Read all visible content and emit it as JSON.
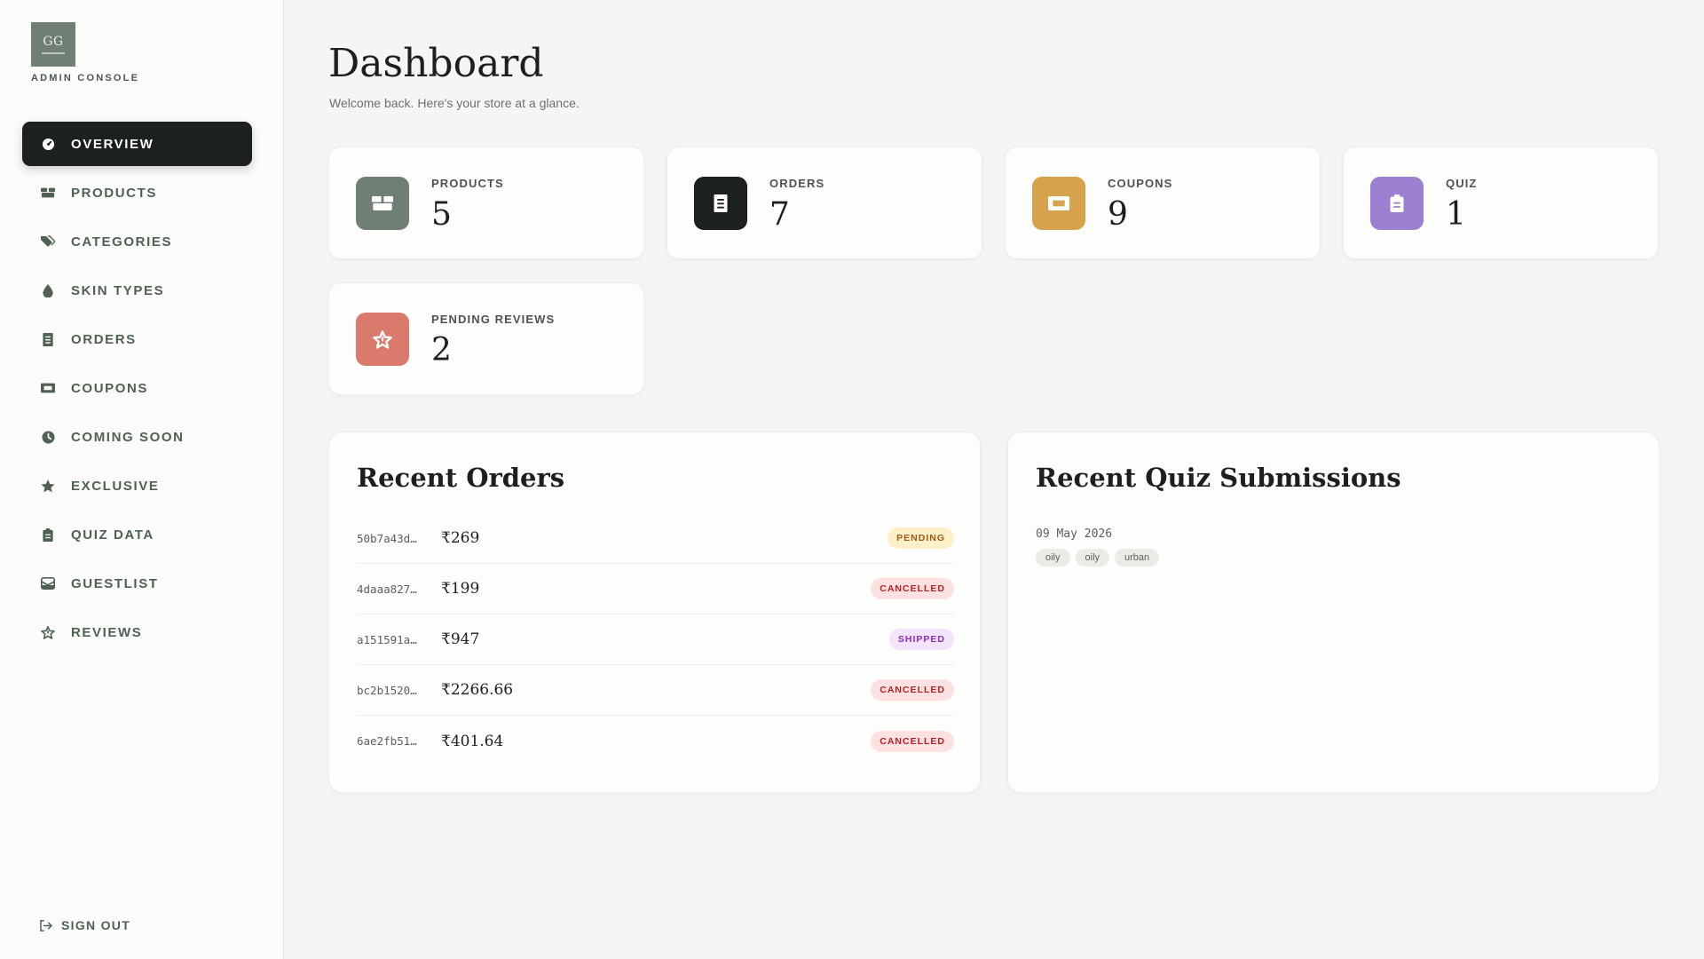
{
  "sidebar": {
    "brand_monogram": "GG",
    "brand_caption": "ADMIN CONSOLE",
    "items": [
      {
        "label": "OVERVIEW",
        "icon": "gauge-icon",
        "active": true
      },
      {
        "label": "PRODUCTS",
        "icon": "boxes-icon"
      },
      {
        "label": "CATEGORIES",
        "icon": "tags-icon"
      },
      {
        "label": "SKIN TYPES",
        "icon": "droplet-icon"
      },
      {
        "label": "ORDERS",
        "icon": "receipt-icon"
      },
      {
        "label": "COUPONS",
        "icon": "ticket-icon"
      },
      {
        "label": "COMING SOON",
        "icon": "clock-icon"
      },
      {
        "label": "EXCLUSIVE",
        "icon": "star-icon"
      },
      {
        "label": "QUIZ DATA",
        "icon": "clipboard-icon"
      },
      {
        "label": "GUESTLIST",
        "icon": "envelope-icon"
      },
      {
        "label": "REVIEWS",
        "icon": "star-outline-icon"
      }
    ],
    "sign_out_label": "SIGN OUT"
  },
  "header": {
    "title": "Dashboard",
    "subtitle": "Welcome back. Here's your store at a glance."
  },
  "stats": [
    {
      "label": "PRODUCTS",
      "value": "5",
      "icon": "boxes-icon",
      "color": "#6f7f73"
    },
    {
      "label": "ORDERS",
      "value": "7",
      "icon": "receipt-icon",
      "color": "#1c211e"
    },
    {
      "label": "COUPONS",
      "value": "9",
      "icon": "ticket-icon",
      "color": "#d7a24c"
    },
    {
      "label": "QUIZ",
      "value": "1",
      "icon": "clipboard-icon",
      "color": "#9b7fd0"
    },
    {
      "label": "PENDING REVIEWS",
      "value": "2",
      "icon": "star-icon",
      "color": "#d97a6c"
    }
  ],
  "recent_orders": {
    "title": "Recent Orders",
    "rows": [
      {
        "id": "50b7a43d…",
        "amount": "₹269",
        "status": "PENDING"
      },
      {
        "id": "4daaa827…",
        "amount": "₹199",
        "status": "CANCELLED"
      },
      {
        "id": "a151591a…",
        "amount": "₹947",
        "status": "SHIPPED"
      },
      {
        "id": "bc2b1520…",
        "amount": "₹2266.66",
        "status": "CANCELLED"
      },
      {
        "id": "6ae2fb51…",
        "amount": "₹401.64",
        "status": "CANCELLED"
      }
    ]
  },
  "recent_quiz": {
    "title": "Recent Quiz Submissions",
    "date": "09 May 2026",
    "tags": [
      "oily",
      "oily",
      "urban"
    ]
  }
}
